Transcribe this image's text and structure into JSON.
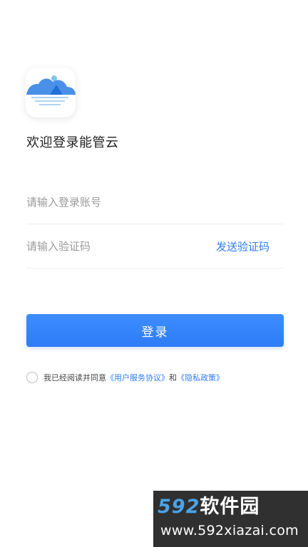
{
  "login": {
    "welcome_text": "欢迎登录能管云",
    "account_placeholder": "请输入登录账号",
    "code_placeholder": "请输入验证码",
    "send_code_label": "发送验证码",
    "login_button_label": "登录"
  },
  "agreement": {
    "prefix": "我已经阅读并同意",
    "user_agreement_link": "《用户服务协议》",
    "connector": "和",
    "privacy_link": "《隐私政策》",
    "checked": false
  },
  "watermark": {
    "number": "592",
    "name": "软件园",
    "url": "www.592xiazai.com"
  },
  "colors": {
    "accent": "#2f7cf6",
    "logo_blue": "#4a90e8",
    "logo_light_blue": "#7fc6f0",
    "watermark_bg": "#303030",
    "watermark_number": "#4aa3e8"
  }
}
